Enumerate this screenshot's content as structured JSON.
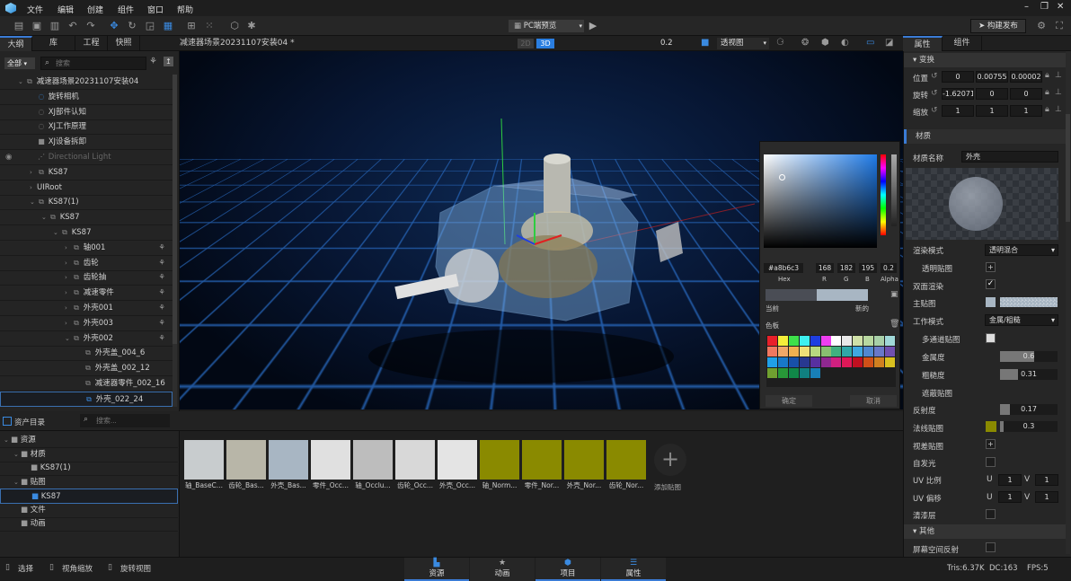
{
  "menu": {
    "items": [
      "文件",
      "编辑",
      "创建",
      "组件",
      "窗口",
      "帮助"
    ]
  },
  "toolbar": {
    "preview_mode": "PC端预览",
    "publish": "构建发布"
  },
  "left_tabs": [
    "大纲",
    "库",
    "工程",
    "快照"
  ],
  "scene_tab": "减速器场景20231107安装04 *",
  "view": {
    "mode2d": "2D",
    "mode3d": "3D",
    "value": "0.2",
    "camera": "透视图"
  },
  "right_tabs": [
    "属性",
    "组件"
  ],
  "outline": {
    "filter": "全部",
    "search_placeholder": "搜索",
    "items": [
      {
        "label": "减速器场景20231107安装04",
        "icon": "group-icon",
        "level": 0,
        "arrow": "v"
      },
      {
        "label": "旋转相机",
        "icon": "rotate-camera-icon",
        "level": 1,
        "arrow": ""
      },
      {
        "label": "XJ部件认知",
        "icon": "rotate-icon",
        "level": 1,
        "arrow": ""
      },
      {
        "label": "XJ工作原理",
        "icon": "rotate-icon",
        "level": 1,
        "arrow": ""
      },
      {
        "label": "XJ设备拆卸",
        "icon": "camera-icon",
        "level": 1,
        "arrow": ""
      },
      {
        "label": "Directional Light",
        "icon": "light-icon",
        "level": 1,
        "arrow": "",
        "dim": true
      },
      {
        "label": "KS87",
        "icon": "group-icon",
        "level": 1,
        "arrow": ">"
      },
      {
        "label": "UIRoot",
        "icon": "",
        "level": 1,
        "arrow": ">"
      },
      {
        "label": "KS87(1)",
        "icon": "group-icon",
        "level": 1,
        "arrow": "v"
      },
      {
        "label": "KS87",
        "icon": "group-icon",
        "level": 2,
        "arrow": "v"
      },
      {
        "label": "KS87",
        "icon": "group-icon",
        "level": 3,
        "arrow": "v"
      },
      {
        "label": "轴001",
        "icon": "group-icon",
        "level": 4,
        "arrow": ">",
        "anim": true
      },
      {
        "label": "齿轮",
        "icon": "group-icon",
        "level": 4,
        "arrow": ">",
        "anim": true
      },
      {
        "label": "齿轮抽",
        "icon": "group-icon",
        "level": 4,
        "arrow": ">",
        "anim": true
      },
      {
        "label": "减速零件",
        "icon": "group-icon",
        "level": 4,
        "arrow": ">",
        "anim": true
      },
      {
        "label": "外壳001",
        "icon": "group-icon",
        "level": 4,
        "arrow": ">",
        "anim": true
      },
      {
        "label": "外壳003",
        "icon": "group-icon",
        "level": 4,
        "arrow": ">",
        "anim": true
      },
      {
        "label": "外壳002",
        "icon": "group-icon",
        "level": 4,
        "arrow": "v",
        "anim": true
      },
      {
        "label": "外壳盖_004_6",
        "icon": "mesh-icon",
        "level": 5,
        "arrow": ""
      },
      {
        "label": "外壳盖_002_12",
        "icon": "mesh-icon",
        "level": 5,
        "arrow": ""
      },
      {
        "label": "减速器零件_002_16",
        "icon": "mesh-icon",
        "level": 5,
        "arrow": ""
      },
      {
        "label": "外壳_022_24",
        "icon": "mesh-icon",
        "level": 5,
        "arrow": "",
        "selected": true
      }
    ]
  },
  "properties": {
    "transform_header": "变换",
    "position": {
      "label": "位置",
      "values": [
        "0",
        "0.00755",
        "0.00002"
      ]
    },
    "rotation": {
      "label": "旋转",
      "values": [
        "-1.62071",
        "0",
        "0"
      ]
    },
    "scale": {
      "label": "缩放",
      "values": [
        "1",
        "1",
        "1"
      ]
    },
    "material_header": "材质",
    "material_name_label": "材质名称",
    "material_name": "外壳",
    "render_mode_label": "渲染模式",
    "render_mode": "透明混合",
    "alpha_map_label": "透明贴图",
    "double_sided_label": "双面渲染",
    "double_sided": true,
    "main_map_label": "主贴图",
    "work_mode_label": "工作模式",
    "work_mode": "金属/粗糙",
    "multichannel_label": "多通道贴图",
    "metallic_label": "金属度",
    "metallic": 0.6,
    "roughness_label": "粗糙度",
    "roughness": 0.31,
    "occlusion_label": "遮蔽贴图",
    "reflectivity_label": "反射度",
    "reflectivity": 0.17,
    "normal_map_label": "法线贴图",
    "normal_strength": 0.3,
    "parallax_label": "视差贴图",
    "emissive_label": "自发光",
    "uv_scale_label": "UV 比例",
    "uv_scale": {
      "u": "1",
      "v": "1"
    },
    "uv_offset_label": "UV 偏移",
    "uv_offset": {
      "u": "1",
      "v": "1"
    },
    "clearcoat_label": "清漆层",
    "other_header": "其他",
    "ssr_label": "屏幕空间反射",
    "u": "U",
    "v": "V"
  },
  "color_picker": {
    "hex": "#a8b6c3",
    "r": "168",
    "g": "182",
    "b": "195",
    "alpha": "0.2",
    "hex_label": "Hex",
    "r_label": "R",
    "g_label": "G",
    "b_label": "B",
    "alpha_label": "Alpha",
    "current_label": "当前",
    "new_label": "新的",
    "palette_label": "色板",
    "ok": "确定",
    "cancel": "取消",
    "current_color": "#4a4d55",
    "new_color": "#a8b6c3",
    "palette": [
      "#e8202a",
      "#f4ee3a",
      "#3ee04a",
      "#3ef0f0",
      "#1e3ee0",
      "#ee3ef0",
      "#ffffff",
      "#e8e8e8",
      "#d0e0a8",
      "#b8d8a0",
      "#a8d0a8",
      "#a0d8d8",
      "#f07860",
      "#f0a868",
      "#f0b050",
      "#f0e078",
      "#b8d880",
      "#88c070",
      "#40b080",
      "#30a8a8",
      "#40a8e0",
      "#5088d0",
      "#6878c8",
      "#7050b0",
      "#20a0e8",
      "#1878c8",
      "#1850a8",
      "#283890",
      "#5830a0",
      "#902890",
      "#d02080",
      "#e01858",
      "#c01020",
      "#d05018",
      "#d08020",
      "#d8c020",
      "#70a030",
      "#289838",
      "#108848",
      "#108080",
      "#1880b8"
    ]
  },
  "assets": {
    "title": "资产目录",
    "search_placeholder": "搜索...",
    "tree": [
      {
        "label": "资源",
        "level": 0
      },
      {
        "label": "材质",
        "level": 1
      },
      {
        "label": "KS87(1)",
        "level": 2
      },
      {
        "label": "贴图",
        "level": 1
      },
      {
        "label": "KS87",
        "level": 2,
        "selected": true
      },
      {
        "label": "文件",
        "level": 1
      },
      {
        "label": "动画",
        "level": 1
      }
    ],
    "thumbs": [
      {
        "label": "轴_BaseC...",
        "color": "#c8ccce"
      },
      {
        "label": "齿轮_Bas...",
        "color": "#b8b6a8"
      },
      {
        "label": "外壳_Bas...",
        "color": "#a8b6c3"
      },
      {
        "label": "零件_Occ...",
        "color": "#e0e0e0"
      },
      {
        "label": "轴_Occlu...",
        "color": "#bdbdbd"
      },
      {
        "label": "齿轮_Occ...",
        "color": "#d8d8d8"
      },
      {
        "label": "外壳_Occ...",
        "color": "#e4e4e4"
      },
      {
        "label": "轴_Norm...",
        "color": "#8a8a00"
      },
      {
        "label": "零件_Nor...",
        "color": "#8a8a00"
      },
      {
        "label": "外壳_Nor...",
        "color": "#8a8a00"
      },
      {
        "label": "齿轮_Nor...",
        "color": "#8a8a00"
      }
    ],
    "add_label": "添加贴图"
  },
  "status": {
    "hints": [
      "选择",
      "视角缩放",
      "旋转视图"
    ],
    "tabs": [
      "资源",
      "动画",
      "项目",
      "属性"
    ],
    "tris": "Tris:6.37K",
    "dc": "DC:163",
    "fps": "FPS:5"
  },
  "colors": {
    "accent": "#3a7bd5"
  }
}
